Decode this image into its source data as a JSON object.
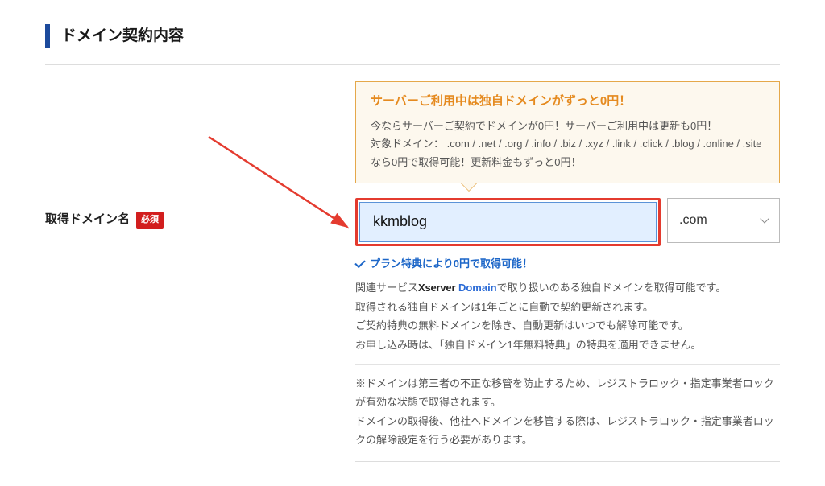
{
  "section": {
    "title": "ドメイン契約内容"
  },
  "field": {
    "label": "取得ドメイン名",
    "required_badge": "必須"
  },
  "promo": {
    "title": "サーバーご利用中は独自ドメインがずっと0円！",
    "line1": "今ならサーバーご契約でドメインが0円！サーバーご利用中は更新も0円！",
    "line2": "対象ドメイン： .com / .net / .org / .info / .biz / .xyz / .link / .click / .blog / .online / .site なら0円で取得可能！更新料金もずっと0円！"
  },
  "domain_input": {
    "value": "kkmblog"
  },
  "tld": {
    "selected": ".com"
  },
  "availability": {
    "message": "プラン特典により0円で取得可能！"
  },
  "desc1": {
    "prefix": "関連サービス",
    "brand_x": "Xserver",
    "brand_spacer": " ",
    "brand_domain": "Domain",
    "suffix": "で取り扱いのある独自ドメインを取得可能です。",
    "line2": "取得される独自ドメインは1年ごとに自動で契約更新されます。",
    "line3": "ご契約特典の無料ドメインを除き、自動更新はいつでも解除可能です。",
    "line4": "お申し込み時は、「独自ドメイン1年無料特典」の特典を適用できません。"
  },
  "desc2": {
    "line1": "※ドメインは第三者の不正な移管を防止するため、レジストラロック・指定事業者ロックが有効な状態で取得されます。",
    "line2": "ドメインの取得後、他社へドメインを移管する際は、レジストラロック・指定事業者ロックの解除設定を行う必要があります。"
  }
}
